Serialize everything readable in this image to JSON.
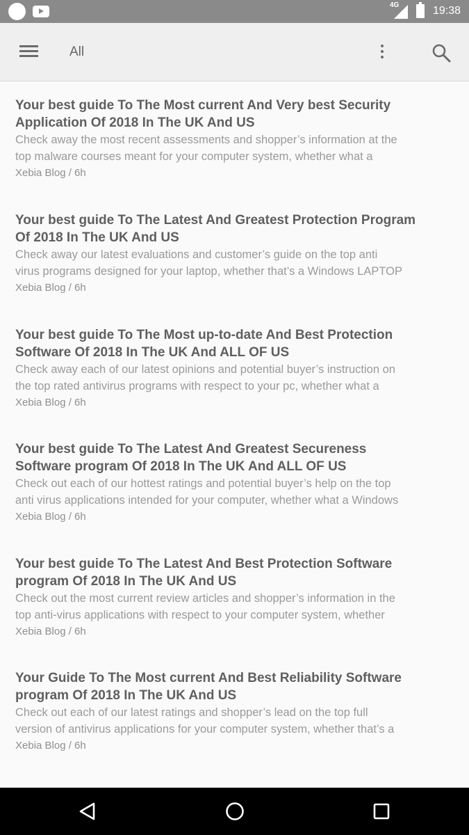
{
  "status_bar": {
    "network_type": "4G",
    "time": "19:38",
    "icons": [
      "notification-dot-icon",
      "youtube-icon",
      "signal-icon",
      "battery-icon"
    ]
  },
  "app_bar": {
    "title": "All",
    "icons": [
      "menu-icon",
      "more-vert-icon",
      "search-icon"
    ]
  },
  "articles": [
    {
      "title_line1": "Your best guide To The Most current And Very best Security",
      "title_line2": "Application Of 2018 In The UK And US",
      "excerpt_line1": "Check away the most recent assessments and shopper’s information at the",
      "excerpt_line2": "top malware courses meant for your computer system, whether what a",
      "meta": "Xebia Blog / 6h"
    },
    {
      "title_line1": "Your best guide To The Latest And Greatest Protection Program",
      "title_line2": "Of 2018 In The UK And US",
      "excerpt_line1": "Check away our latest evaluations and customer’s guide on the top anti",
      "excerpt_line2": "virus programs designed for your laptop, whether that’s a Windows LAPTOP",
      "meta": "Xebia Blog / 6h"
    },
    {
      "title_line1": "Your best guide To The Most up-to-date And Best Protection",
      "title_line2": "Software Of 2018 In The UK And ALL OF US",
      "excerpt_line1": "Check away each of our latest opinions and potential buyer’s instruction on",
      "excerpt_line2": "the top rated antivirus programs with respect to your pc, whether what a",
      "meta": "Xebia Blog / 6h"
    },
    {
      "title_line1": "Your best guide To The Latest And Greatest Secureness",
      "title_line2": "Software program Of 2018 In The UK And ALL OF US",
      "excerpt_line1": "Check out each of our hottest ratings and potential buyer’s help on the top",
      "excerpt_line2": "anti virus applications intended for your computer, whether what a Windows",
      "meta": "Xebia Blog / 6h"
    },
    {
      "title_line1": "Your best guide To The Latest And Best Protection Software",
      "title_line2": "program Of 2018 In The UK And US",
      "excerpt_line1": "Check out the most current review articles and shopper’s information in the",
      "excerpt_line2": "top anti-virus applications with respect to your computer system, whether",
      "meta": "Xebia Blog / 6h"
    },
    {
      "title_line1": "Your Guide To The Most current And Best Reliability Software",
      "title_line2": "program Of 2018 In The UK And US",
      "excerpt_line1": "Check out each of our latest ratings and shopper’s lead on the top full",
      "excerpt_line2": "version of antivirus applications for your computer system, whether that’s a",
      "meta": "Xebia Blog / 6h"
    }
  ],
  "nav_bar": {
    "icons": [
      "back-icon",
      "home-icon",
      "recents-icon"
    ]
  }
}
